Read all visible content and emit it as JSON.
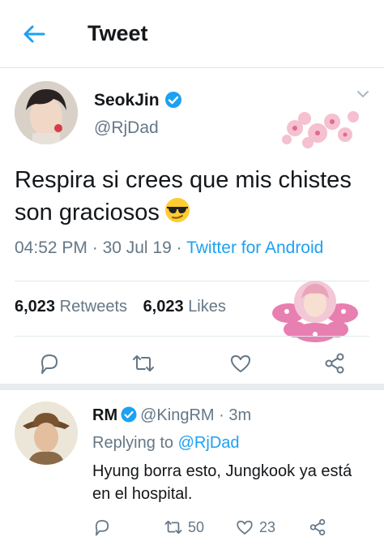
{
  "header": {
    "title": "Tweet",
    "back_icon": "back-arrow-icon"
  },
  "colors": {
    "accent": "#1da1f2",
    "muted": "#657786",
    "text": "#14171a"
  },
  "tweet": {
    "author_name": "SeokJin",
    "author_handle": "@RjDad",
    "text": "Respira si crees que mis chistes son graciosos",
    "emoji": "sunglasses-emoji",
    "time": "04:52 PM",
    "date": "30 Jul 19",
    "source": "Twitter for Android",
    "retweets_count": "6,023",
    "retweets_label": "Retweets",
    "likes_count": "6,023",
    "likes_label": "Likes",
    "actions": [
      "reply-icon",
      "retweet-icon",
      "like-icon",
      "share-icon"
    ]
  },
  "reply": {
    "author_name": "RM",
    "author_handle": "@KingRM",
    "time": "3m",
    "replying_prefix": "Replying to",
    "replying_to": "@RjDad",
    "text": "Hyung borra esto, Jungkook ya está en el hospital.",
    "retweets": "50",
    "likes": "23"
  }
}
